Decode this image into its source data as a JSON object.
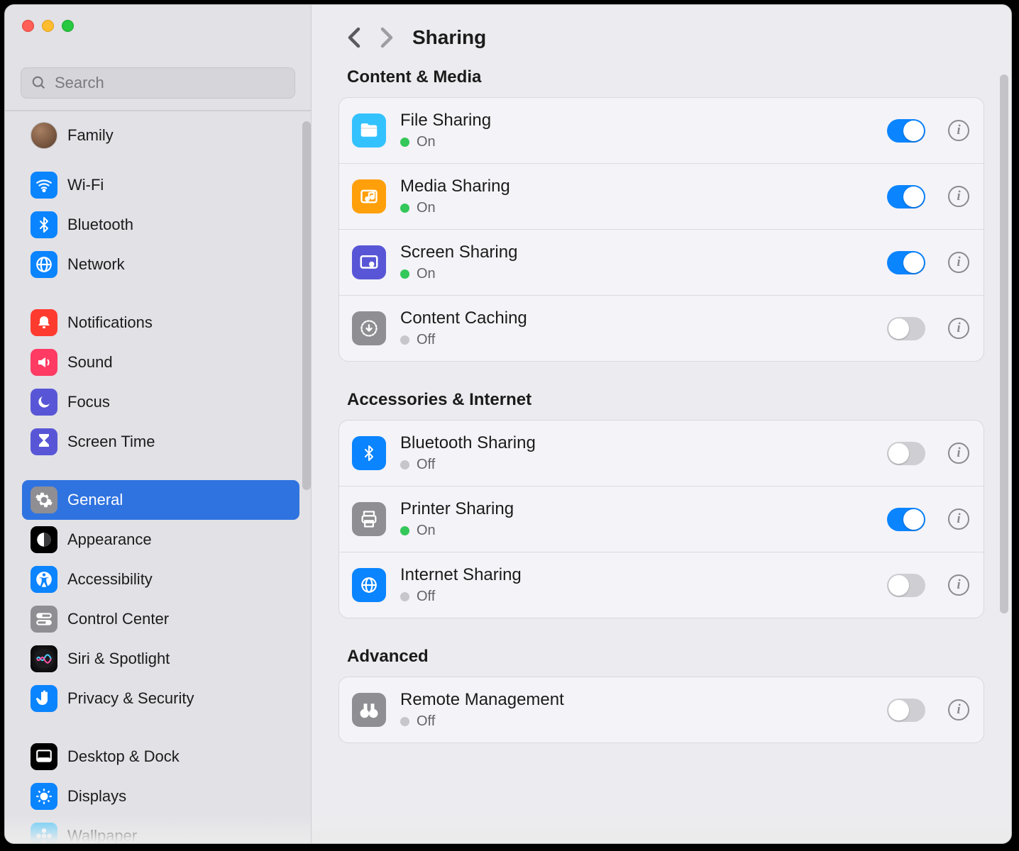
{
  "search": {
    "placeholder": "Search"
  },
  "page": {
    "title": "Sharing"
  },
  "sidebar": {
    "groups": [
      [
        {
          "id": "family",
          "label": "Family",
          "icon": "avatar"
        }
      ],
      [
        {
          "id": "wifi",
          "label": "Wi-Fi",
          "icon": "wifi",
          "bg": "#0a84ff"
        },
        {
          "id": "bluetooth",
          "label": "Bluetooth",
          "icon": "bluetooth",
          "bg": "#0a84ff"
        },
        {
          "id": "network",
          "label": "Network",
          "icon": "globe",
          "bg": "#0a84ff"
        }
      ],
      [
        {
          "id": "notifications",
          "label": "Notifications",
          "icon": "bell",
          "bg": "#ff3b30"
        },
        {
          "id": "sound",
          "label": "Sound",
          "icon": "speaker",
          "bg": "#ff3b63"
        },
        {
          "id": "focus",
          "label": "Focus",
          "icon": "moon",
          "bg": "#5856d6"
        },
        {
          "id": "screentime",
          "label": "Screen Time",
          "icon": "hourglass",
          "bg": "#5856d6"
        }
      ],
      [
        {
          "id": "general",
          "label": "General",
          "icon": "gear",
          "bg": "#8e8e93",
          "selected": true
        },
        {
          "id": "appearance",
          "label": "Appearance",
          "icon": "appearance",
          "bg": "#000000"
        },
        {
          "id": "accessibility",
          "label": "Accessibility",
          "icon": "accessibility",
          "bg": "#0a84ff"
        },
        {
          "id": "controlcenter",
          "label": "Control Center",
          "icon": "switches",
          "bg": "#8e8e93"
        },
        {
          "id": "siri",
          "label": "Siri & Spotlight",
          "icon": "siri",
          "bg": "grad"
        },
        {
          "id": "privacy",
          "label": "Privacy & Security",
          "icon": "hand",
          "bg": "#0a84ff"
        }
      ],
      [
        {
          "id": "desktop",
          "label": "Desktop & Dock",
          "icon": "dock",
          "bg": "#000000"
        },
        {
          "id": "displays",
          "label": "Displays",
          "icon": "sun",
          "bg": "#0a84ff"
        },
        {
          "id": "wallpaper",
          "label": "Wallpaper",
          "icon": "flower",
          "bg": "#5ac8fa"
        }
      ]
    ]
  },
  "status_labels": {
    "on": "On",
    "off": "Off"
  },
  "sections": [
    {
      "title": "Content & Media",
      "rows": [
        {
          "id": "file-sharing",
          "title": "File Sharing",
          "on": true,
          "icon": "folder",
          "bg": "#34c2ff"
        },
        {
          "id": "media-sharing",
          "title": "Media Sharing",
          "on": true,
          "icon": "media",
          "bg": "#ff9f0a"
        },
        {
          "id": "screen-sharing",
          "title": "Screen Sharing",
          "on": true,
          "icon": "screen",
          "bg": "#5856d6"
        },
        {
          "id": "content-caching",
          "title": "Content Caching",
          "on": false,
          "icon": "download",
          "bg": "#8e8e93"
        }
      ]
    },
    {
      "title": "Accessories & Internet",
      "rows": [
        {
          "id": "bluetooth-sharing",
          "title": "Bluetooth Sharing",
          "on": false,
          "icon": "bluetooth",
          "bg": "#0a84ff"
        },
        {
          "id": "printer-sharing",
          "title": "Printer Sharing",
          "on": true,
          "icon": "printer",
          "bg": "#8e8e93"
        },
        {
          "id": "internet-sharing",
          "title": "Internet Sharing",
          "on": false,
          "icon": "globe",
          "bg": "#0a84ff"
        }
      ]
    },
    {
      "title": "Advanced",
      "rows": [
        {
          "id": "remote-management",
          "title": "Remote Management",
          "on": false,
          "icon": "binoculars",
          "bg": "#8e8e93"
        }
      ]
    }
  ]
}
